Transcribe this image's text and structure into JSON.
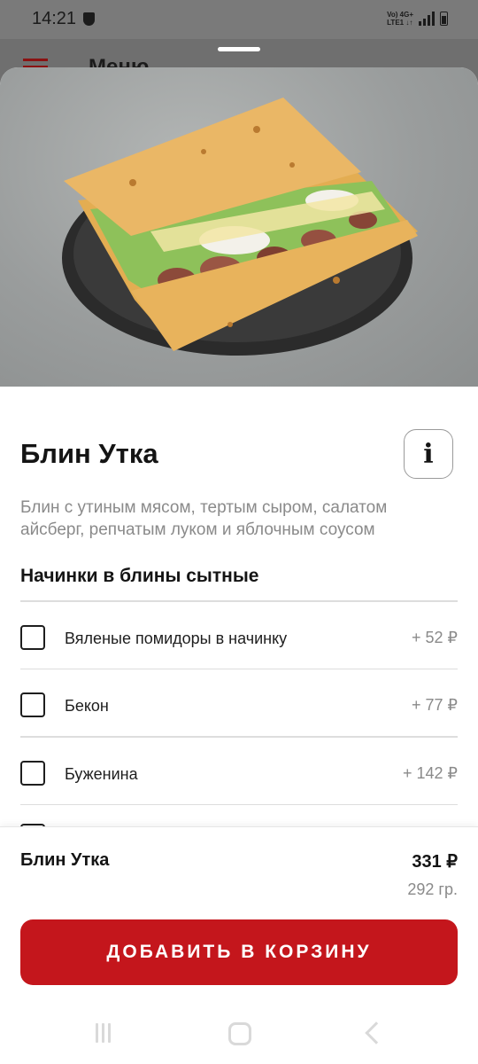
{
  "status_bar": {
    "time": "14:21",
    "net_top": "Vo) 4G+",
    "net_bottom": "LTE1 ↓↑"
  },
  "background_app": {
    "title": "Меню"
  },
  "product": {
    "image_icon": "crepe-photo",
    "title": "Блин Утка",
    "info_icon": "i",
    "description": "Блин с утиным мясом, тертым сыром, салатом айсберг, репчатым луком и яблочным соусом"
  },
  "options_section": {
    "title": "Начинки в блины сытные",
    "items": [
      {
        "label": "Вяленые помидоры в начинку",
        "price": "+ 52 ₽",
        "checked": false
      },
      {
        "label": "Бекон",
        "price": "+ 77 ₽",
        "checked": false
      },
      {
        "label": "Буженина",
        "price": "+ 142 ₽",
        "checked": false
      }
    ]
  },
  "summary": {
    "name": "Блин Утка",
    "price": "331 ₽",
    "weight": "292 гр."
  },
  "add_button": {
    "label": "ДОБАВИТЬ В КОРЗИНУ"
  },
  "colors": {
    "accent": "#c4161c",
    "text": "#141414",
    "muted": "#8a8a8a"
  }
}
